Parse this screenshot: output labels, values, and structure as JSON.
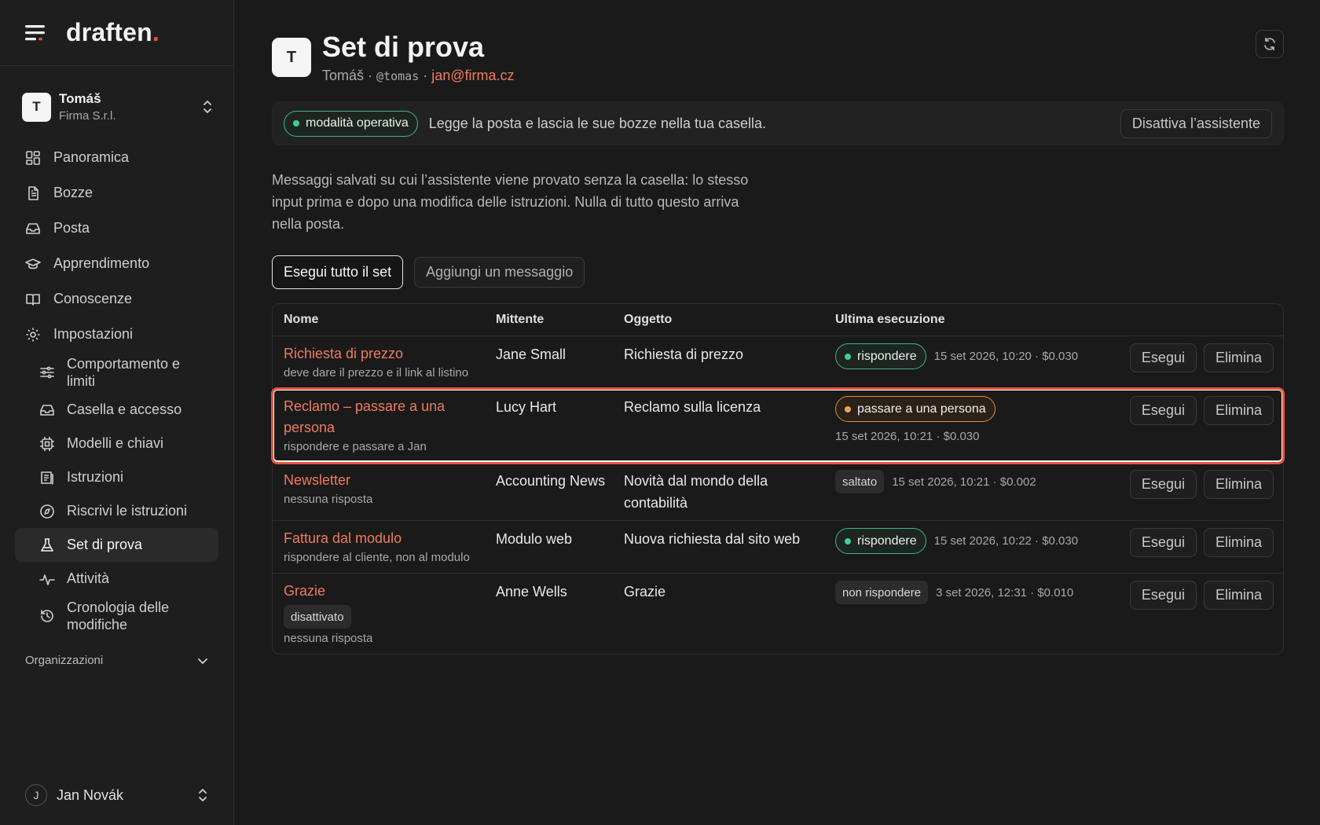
{
  "brand": {
    "name": "draften",
    "dot": "."
  },
  "account": {
    "initial": "T",
    "name": "Tomáš",
    "org": "Firma S.r.l."
  },
  "nav": {
    "overview": "Panoramica",
    "drafts": "Bozze",
    "mail": "Posta",
    "learning": "Apprendimento",
    "knowledge": "Conoscenze",
    "settings": "Impostazioni",
    "sub": {
      "behavior": "Comportamento e limiti",
      "mailbox": "Casella e accesso",
      "models": "Modelli e chiavi",
      "instructions": "Istruzioni",
      "rewrite": "Riscrivi le istruzioni",
      "testset": "Set di prova",
      "activity": "Attività",
      "history": "Cronologia delle modifiche"
    }
  },
  "organizations": "Organizzazioni",
  "user": {
    "initial": "J",
    "name": "Jan Novák"
  },
  "header": {
    "initial": "T",
    "title": "Set di prova",
    "owner": "Tomáš",
    "sep": "·",
    "handle": "@tomas",
    "email": "jan@firma.cz"
  },
  "mode": {
    "pill": "modalità operativa",
    "description": "Legge la posta e lascia le sue bozze nella tua casella.",
    "disable": "Disattiva l’assistente"
  },
  "intro": "Messaggi salvati su cui l’assistente viene provato senza la casella: lo stesso input prima e dopo una modifica delle istruzioni. Nulla di tutto questo arriva nella posta.",
  "actions": {
    "run_all": "Esegui tutto il set",
    "add": "Aggiungi un messaggio"
  },
  "table": {
    "headers": {
      "name": "Nome",
      "sender": "Mittente",
      "subject": "Oggetto",
      "last_run": "Ultima esecuzione"
    },
    "run_label": "Esegui",
    "delete_label": "Elimina",
    "rows": [
      {
        "name": "Richiesta di prezzo",
        "hint": "deve dare il prezzo e il link al listino",
        "sender": "Jane Small",
        "subject": "Richiesta di prezzo",
        "result": "rispondere",
        "result_kind": "green",
        "meta": "15 set 2026, 10:20 · $0.030"
      },
      {
        "name": "Reclamo – passare a una persona",
        "hint": "rispondere e passare a Jan",
        "sender": "Lucy Hart",
        "subject": "Reclamo sulla licenza",
        "result": "passare a una persona",
        "result_kind": "orange",
        "meta": "15 set 2026, 10:21 · $0.030"
      },
      {
        "name": "Newsletter",
        "hint": "nessuna risposta",
        "sender": "Accounting News",
        "subject": "Novità dal mondo della contabilità",
        "result": "saltato",
        "result_kind": "tag",
        "meta": "15 set 2026, 10:21 · $0.002"
      },
      {
        "name": "Fattura dal modulo",
        "hint": "rispondere al cliente, non al modulo",
        "sender": "Modulo web",
        "subject": "Nuova richiesta dal sito web",
        "result": "rispondere",
        "result_kind": "green",
        "meta": "15 set 2026, 10:22 · $0.030"
      },
      {
        "name": "Grazie",
        "tag": "disattivato",
        "hint": "nessuna risposta",
        "sender": "Anne Wells",
        "subject": "Grazie",
        "result": "non rispondere",
        "result_kind": "tag",
        "meta": "3 set 2026, 12:31 · $0.010"
      }
    ]
  },
  "colors": {
    "accent": "#ef7b5e",
    "brand_dot": "#e2553f",
    "green": "#3fcf8e",
    "orange": "#f0a04b",
    "highlight": "#e4563f"
  },
  "icons": [
    "menu-icon",
    "grid-icon",
    "document-icon",
    "inbox-icon",
    "graduation-cap-icon",
    "book-icon",
    "gear-icon",
    "sliders-icon",
    "inbox-icon",
    "chip-icon",
    "list-icon",
    "compass-icon",
    "flask-icon",
    "activity-icon",
    "history-icon",
    "chevron-down-icon",
    "chevrons-updown-icon",
    "refresh-icon"
  ]
}
